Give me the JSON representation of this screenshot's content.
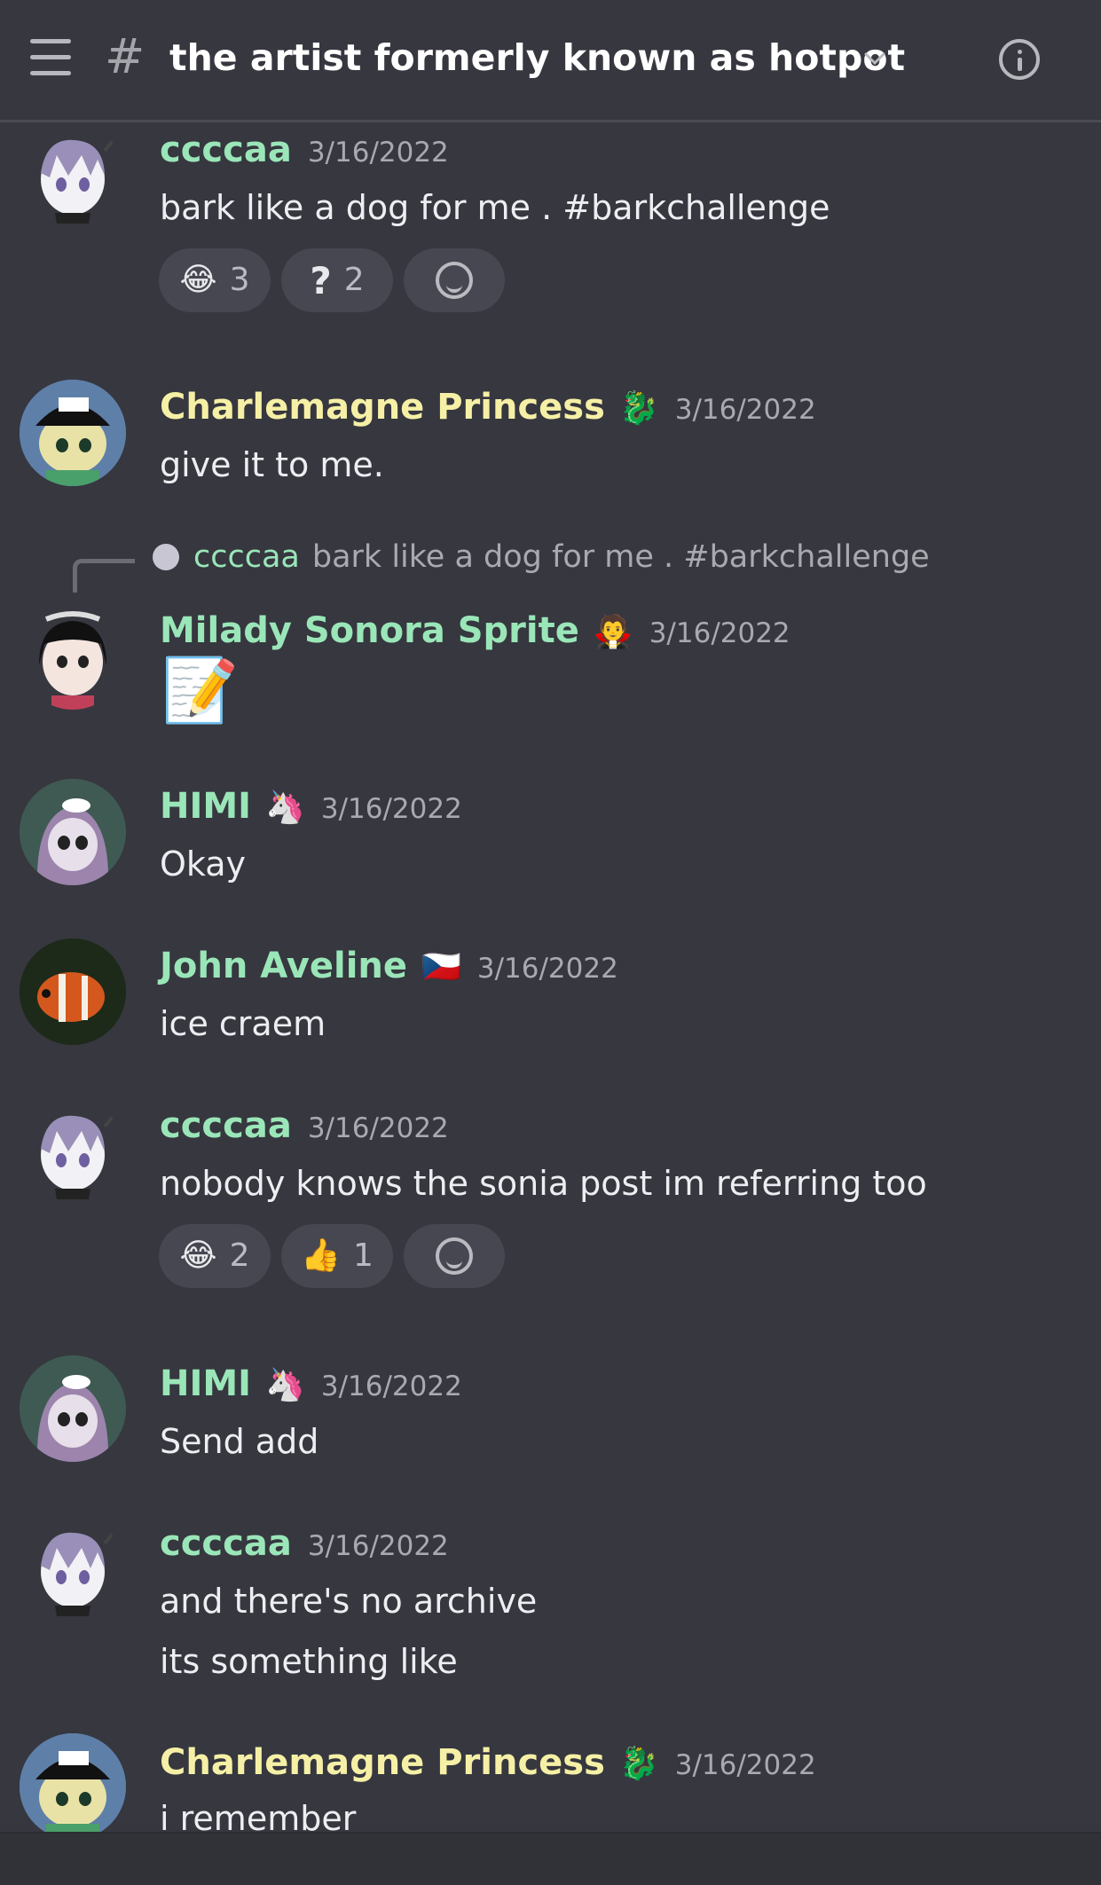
{
  "header": {
    "channel_prefix": "#",
    "channel_name": "the artist formerly known as hotpot"
  },
  "colors": {
    "background": "#36373f",
    "username_green": "#9ae6b8",
    "username_yellow": "#f6f0a6",
    "timestamp": "#a8aab0",
    "reaction_bg": "#464750"
  },
  "messages": [
    {
      "author": "ccccaa",
      "timestamp": "3/16/2022",
      "lines": [
        "bark like a dog for me .  #barkchallenge"
      ],
      "reactions": [
        {
          "emoji": "😂",
          "count": "3"
        },
        {
          "emoji": "?",
          "count": "2"
        }
      ]
    },
    {
      "author": "Charlemagne Princess",
      "badge": "🐉",
      "timestamp": "3/16/2022",
      "lines": [
        "give it to me."
      ]
    },
    {
      "reply": {
        "author": "ccccaa",
        "text": "bark like a dog for me .  #barkchallenge"
      },
      "author": "Milady Sonora Sprite",
      "badge": "🧛",
      "timestamp": "3/16/2022",
      "lines": [
        "📝"
      ]
    },
    {
      "author": "HIMI",
      "badge": "🦄",
      "timestamp": "3/16/2022",
      "lines": [
        "Okay"
      ]
    },
    {
      "author": "John Aveline",
      "badge": "🇨🇿",
      "timestamp": "3/16/2022",
      "lines": [
        "ice craem"
      ]
    },
    {
      "author": "ccccaa",
      "timestamp": "3/16/2022",
      "lines": [
        "nobody knows the sonia post im referring too"
      ],
      "reactions": [
        {
          "emoji": "😂",
          "count": "2"
        },
        {
          "emoji": "👍",
          "count": "1"
        }
      ]
    },
    {
      "author": "HIMI",
      "badge": "🦄",
      "timestamp": "3/16/2022",
      "lines": [
        "Send add"
      ]
    },
    {
      "author": "ccccaa",
      "timestamp": "3/16/2022",
      "lines": [
        "and there's no archive",
        "its something like"
      ]
    },
    {
      "author": "Charlemagne Princess",
      "badge": "🐉",
      "timestamp": "3/16/2022",
      "lines": [
        "i remember"
      ]
    }
  ]
}
